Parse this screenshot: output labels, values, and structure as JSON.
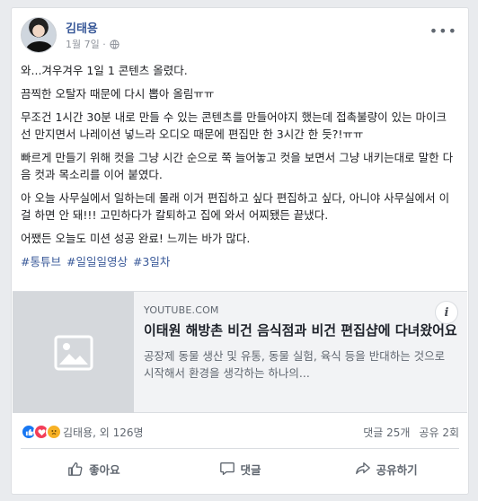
{
  "post": {
    "author": "김태용",
    "date": "1월 7일 ·",
    "privacy_icon": "globe-icon",
    "more_icon": "more-horizontal-icon",
    "paragraphs": [
      "와...겨우겨우 1일 1 콘텐츠 올렸다.",
      "끔찍한 오탈자 때문에 다시 뽑아 올림ㅠㅠ",
      "무조건 1시간 30분 내로 만들 수 있는 콘텐츠를 만들어야지 했는데 접촉불량이 있는 마이크 선 만지면서 나레이션 넣느라 오디오 때문에 편집만 한 3시간 한 듯?!ㅠㅠ",
      "빠르게 만들기 위해 컷을 그냥 시간 순으로 쭉 늘어놓고 컷을 보면서 그냥 내키는대로 말한 다음 컷과 목소리를 이어 붙였다.",
      "아 오늘 사무실에서 일하는데 몰래 이거 편집하고 싶다 편집하고 싶다, 아니야 사무실에서 이걸 하면 안 돼!!! 고민하다가 칼퇴하고 집에 와서 어찌됐든 끝냈다.",
      "어쨌든 오늘도 미션 성공 완료! 느끼는 바가 많다."
    ],
    "hashtags": [
      "#통튜브",
      "#일일일영상",
      "#3일차"
    ]
  },
  "link": {
    "domain": "YOUTUBE.COM",
    "title": "이태원 해방촌 비건 음식점과 비건 편집샵에 다녀왔어요",
    "description": "공장제 동물 생산 및 유통, 동물 실험, 육식 등을 반대하는 것으로 시작해서 환경을 생각하는 하나의...",
    "info_label": "i"
  },
  "stats": {
    "reactors": "김태용, 외 126명",
    "comments": "댓글 25개",
    "shares": "공유 2회"
  },
  "actions": {
    "like": "좋아요",
    "comment": "댓글",
    "share": "공유하기"
  },
  "colors": {
    "link_blue": "#385898",
    "like_blue": "#1877f2",
    "love_red": "#f33e58",
    "sad_yellow": "#f7b125"
  }
}
